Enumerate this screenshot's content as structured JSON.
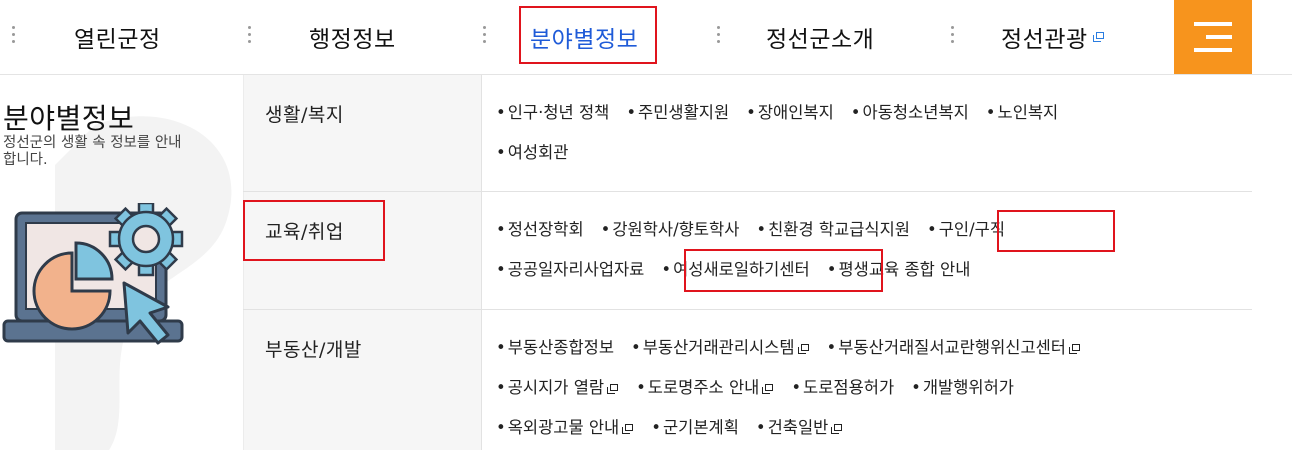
{
  "nav": {
    "items": [
      {
        "label": "열린군정"
      },
      {
        "label": "행정정보"
      },
      {
        "label": "분야별정보",
        "active": true
      },
      {
        "label": "정선군소개"
      },
      {
        "label": "정선관광",
        "external": true
      }
    ],
    "menu_icon": "hamburger-menu-icon",
    "colors": {
      "accent": "#1f5bd8",
      "menu_bg": "#f7941d",
      "highlight": "#e0141d"
    }
  },
  "side": {
    "title": "분야별정보",
    "desc": "정선군의 생활 속 정보를 안내합니다."
  },
  "table": {
    "bullet": "•",
    "rows": [
      {
        "category": "생활/복지",
        "lines": [
          [
            "인구·청년 정책",
            "주민생활지원",
            "장애인복지",
            "아동청소년복지",
            "노인복지"
          ],
          [
            "여성회관"
          ]
        ]
      },
      {
        "category": "교육/취업",
        "lines": [
          [
            "정선장학회",
            "강원학사/향토학사",
            "친환경 학교급식지원",
            "구인/구직"
          ],
          [
            "공공일자리사업자료",
            "여성새로일하기센터",
            "평생교육 종합 안내"
          ]
        ]
      },
      {
        "category": "부동산/개발",
        "lines": [
          [
            "부동산종합정보",
            "부동산거래관리시스템",
            "부동산거래질서교란행위신고센터"
          ],
          [
            "공시지가 열람",
            "도로명주소 안내",
            "도로점용허가",
            "개발행위허가"
          ],
          [
            "옥외광고물 안내",
            "군기본계획",
            "건축일반"
          ]
        ]
      }
    ]
  }
}
